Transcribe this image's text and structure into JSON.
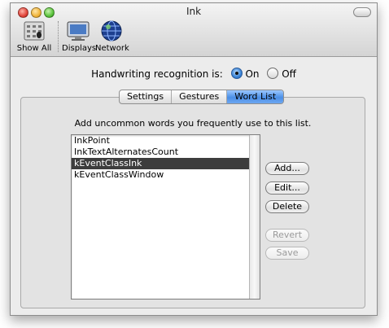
{
  "window": {
    "title": "Ink"
  },
  "toolbar": {
    "items": [
      {
        "label": "Show All",
        "icon": "show-all-icon"
      },
      {
        "label": "Displays",
        "icon": "displays-icon"
      },
      {
        "label": "Network",
        "icon": "network-globe-icon"
      }
    ]
  },
  "handwriting": {
    "label": "Handwriting recognition is:",
    "options": [
      {
        "label": "On",
        "selected": true
      },
      {
        "label": "Off",
        "selected": false
      }
    ]
  },
  "tabs": [
    {
      "label": "Settings",
      "active": false
    },
    {
      "label": "Gestures",
      "active": false
    },
    {
      "label": "Word List",
      "active": true
    }
  ],
  "word_list": {
    "instructions": "Add uncommon words you frequently use to this list.",
    "items": [
      "InkPoint",
      "InkTextAlternatesCount",
      "kEventClassInk",
      "kEventClassWindow"
    ],
    "selected_index": 2
  },
  "buttons": {
    "add": "Add...",
    "edit": "Edit...",
    "delete": "Delete",
    "revert": "Revert",
    "save": "Save"
  }
}
